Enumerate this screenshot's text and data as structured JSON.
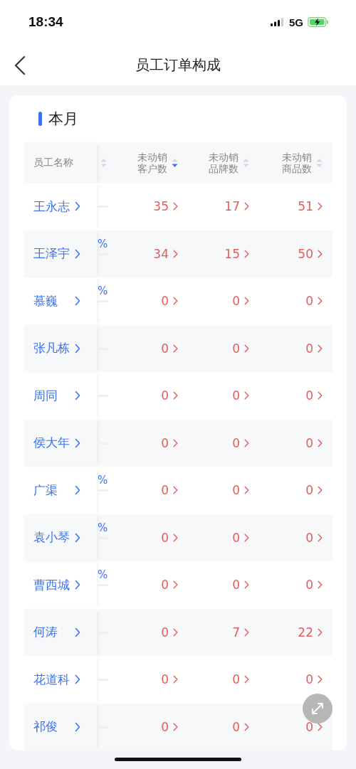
{
  "status_bar": {
    "time": "18:34",
    "network": "5G"
  },
  "nav": {
    "title": "员工订单构成"
  },
  "section": {
    "title": "本月"
  },
  "table": {
    "columns": [
      {
        "label": "员工名称"
      },
      {
        "label_lines": [
          "未动销",
          "客户数"
        ],
        "sorted_desc": true
      },
      {
        "label_lines": [
          "未动销",
          "品牌数"
        ],
        "sorted_desc": false
      },
      {
        "label_lines": [
          "未动销",
          "商品数"
        ],
        "sorted_desc": false
      }
    ],
    "hidden_column_sorted_desc": false,
    "rows": [
      {
        "name": "王永志",
        "values": [
          "35",
          "17",
          "51"
        ]
      },
      {
        "name": "王泽宇",
        "fragment": "%",
        "values": [
          "34",
          "15",
          "50"
        ]
      },
      {
        "name": "慕巍",
        "fragment": "%",
        "values": [
          "0",
          "0",
          "0"
        ]
      },
      {
        "name": "张凡栋",
        "values": [
          "0",
          "0",
          "0"
        ]
      },
      {
        "name": "周同",
        "values": [
          "0",
          "0",
          "0"
        ]
      },
      {
        "name": "侯大年",
        "values": [
          "0",
          "0",
          "0"
        ]
      },
      {
        "name": "广渠",
        "fragment": "%",
        "values": [
          "0",
          "0",
          "0"
        ]
      },
      {
        "name": "袁小琴",
        "fragment": "%",
        "values": [
          "0",
          "0",
          "0"
        ]
      },
      {
        "name": "曹西城",
        "fragment": "%",
        "values": [
          "0",
          "0",
          "0"
        ]
      },
      {
        "name": "何涛",
        "values": [
          "0",
          "7",
          "22"
        ]
      },
      {
        "name": "花道科",
        "values": [
          "0",
          "0",
          "0"
        ]
      },
      {
        "name": "祁俊",
        "values": [
          "0",
          "0",
          "0"
        ]
      }
    ]
  }
}
